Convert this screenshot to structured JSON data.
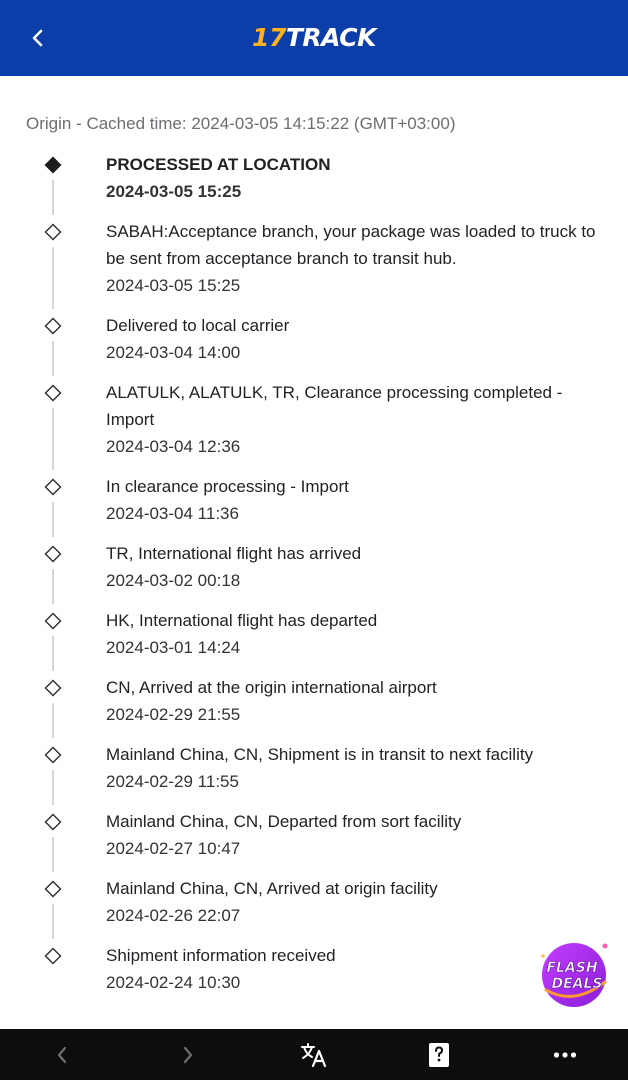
{
  "header": {
    "logo_num": "17",
    "logo_word": "TRACK"
  },
  "origin_line": "Origin - Cached time: 2024-03-05 14:15:22 (GMT+03:00)",
  "events": [
    {
      "desc": "PROCESSED AT LOCATION",
      "time": "2024-03-05 15:25",
      "current": true
    },
    {
      "desc": "SABAH:Acceptance branch, your package was loaded to truck to be sent from acceptance branch to transit hub.",
      "time": "2024-03-05 15:25"
    },
    {
      "desc": "Delivered to local carrier",
      "time": "2024-03-04 14:00"
    },
    {
      "desc": "ALATULK, ALATULK, TR, Clearance processing completed - Import",
      "time": "2024-03-04 12:36"
    },
    {
      "desc": "In clearance processing - Import",
      "time": "2024-03-04 11:36"
    },
    {
      "desc": "TR, International flight has arrived",
      "time": "2024-03-02 00:18"
    },
    {
      "desc": "HK, International flight has departed",
      "time": "2024-03-01 14:24"
    },
    {
      "desc": "CN, Arrived at the origin international airport",
      "time": "2024-02-29 21:55"
    },
    {
      "desc": "Mainland China, CN, Shipment is in transit to next facility",
      "time": "2024-02-29 11:55"
    },
    {
      "desc": "Mainland China, CN, Departed from sort facility",
      "time": "2024-02-27 10:47"
    },
    {
      "desc": "Mainland China, CN, Arrived at origin facility",
      "time": "2024-02-26 22:07"
    },
    {
      "desc": "Shipment information received",
      "time": "2024-02-24 10:30"
    }
  ],
  "flash_deals": {
    "line1": "FLASH",
    "line2": "DEALS"
  },
  "colors": {
    "header_bg": "#0b3ea8",
    "logo_accent": "#ffb21e",
    "bottom_bar_bg": "#0d0d0d"
  },
  "bottom_bar": {
    "icons": [
      "back-arrow-icon",
      "forward-arrow-icon",
      "translate-icon",
      "help-icon",
      "more-icon"
    ]
  }
}
